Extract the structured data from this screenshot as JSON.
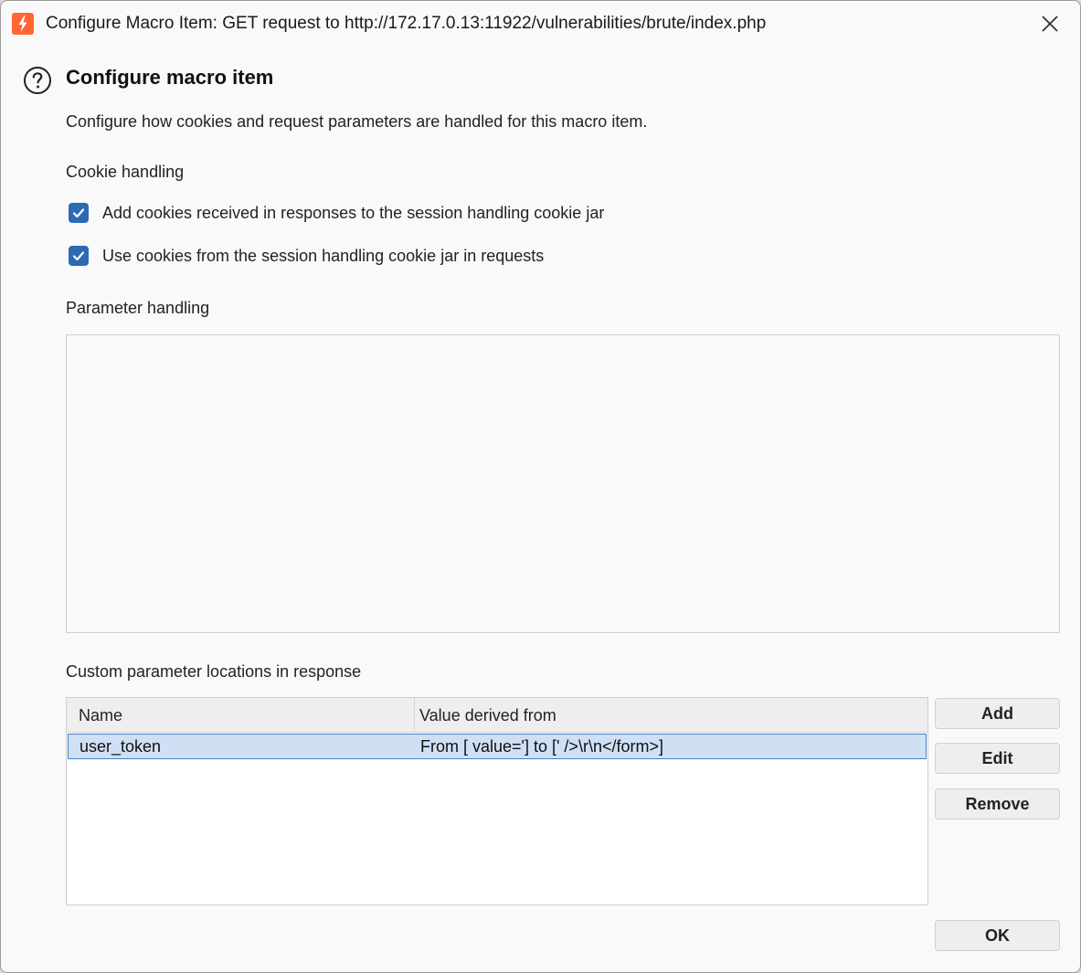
{
  "window": {
    "title": "Configure Macro Item: GET request to http://172.17.0.13:11922/vulnerabilities/brute/index.php",
    "icons": {
      "app": "burp-lightning-icon",
      "close": "close-icon",
      "help": "help-icon"
    },
    "colors": {
      "app_icon": "#ff6633",
      "checkbox": "#2c6ab2",
      "selection": "#cfe0f5"
    }
  },
  "header": {
    "title": "Configure macro item",
    "description": "Configure how cookies and request parameters are handled for this macro item."
  },
  "cookie_handling": {
    "label": "Cookie handling",
    "options": [
      {
        "label": "Add cookies received in responses to the session handling cookie jar",
        "checked": true
      },
      {
        "label": "Use cookies from the session handling cookie jar in requests",
        "checked": true
      }
    ]
  },
  "parameter_handling": {
    "label": "Parameter handling"
  },
  "custom_locations": {
    "label": "Custom parameter locations in response",
    "columns": [
      "Name",
      "Value derived from"
    ],
    "rows": [
      {
        "name": "user_token",
        "value": "From [ value='] to [' />\\r\\n</form>]",
        "selected": true
      }
    ]
  },
  "buttons": {
    "add": "Add",
    "edit": "Edit",
    "remove": "Remove",
    "ok": "OK"
  }
}
